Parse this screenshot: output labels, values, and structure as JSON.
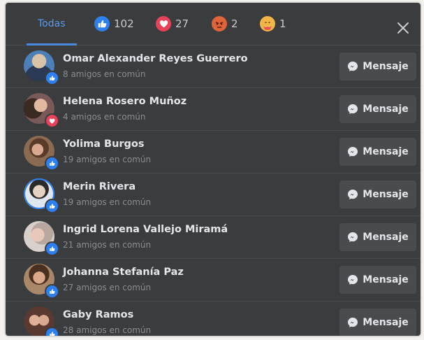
{
  "tabs": {
    "all_label": "Todas",
    "like_count": "102",
    "love_count": "27",
    "angry_count": "2",
    "care_count": "1"
  },
  "people": [
    {
      "name": "Omar Alexander Reyes Guerrero",
      "mutual": "8 amigos en común",
      "reaction": "like"
    },
    {
      "name": "Helena Rosero Muñoz",
      "mutual": "4 amigos en común",
      "reaction": "love"
    },
    {
      "name": "Yolima Burgos",
      "mutual": "19 amigos en común",
      "reaction": "like"
    },
    {
      "name": "Merin Rivera",
      "mutual": "19 amigos en común",
      "reaction": "like"
    },
    {
      "name": "Ingrid Lorena Vallejo Miramá",
      "mutual": "21 amigos en común",
      "reaction": "like"
    },
    {
      "name": "Johanna Stefanía Paz",
      "mutual": "27 amigos en común",
      "reaction": "like"
    },
    {
      "name": "Gaby Ramos",
      "mutual": "28 amigos en común",
      "reaction": "like"
    }
  ],
  "message_button_label": "Mensaje",
  "colors": {
    "panel_bg": "#3b3c3e",
    "accent": "#4a88dc",
    "like": "#2e7ff0",
    "love": "#e8415a",
    "angry": "#e0643a",
    "care": "#f0b648"
  }
}
